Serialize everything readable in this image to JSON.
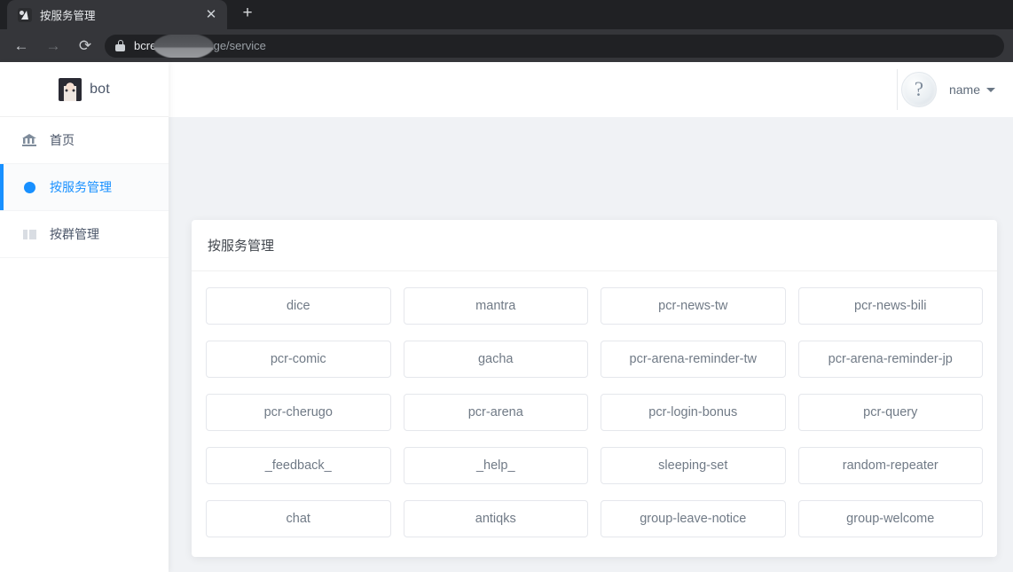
{
  "browser": {
    "tab": {
      "title": "按服务管理",
      "close_label": "✕",
      "favicon": "bot-bolt-icon"
    },
    "new_tab_label": "+",
    "nav": {
      "back": "←",
      "forward": "→",
      "reload": "⟳"
    },
    "omnibox": {
      "lock_icon": "lock-icon",
      "url_host_prefix": "bcr",
      "url_host_suffix": "e.com",
      "url_path": "/manage/service"
    }
  },
  "sidebar": {
    "brand": {
      "avatar": "bot-avatar",
      "name": "bot"
    },
    "items": [
      {
        "label": "首页",
        "icon": "bank-icon",
        "active": false
      },
      {
        "label": "按服务管理",
        "icon": "blue-dot-icon",
        "active": true
      },
      {
        "label": "按群管理",
        "icon": "grid-icon",
        "active": false
      }
    ]
  },
  "header": {
    "avatar_glyph": "?",
    "user_name": "name",
    "caret_icon": "chevron-down-icon"
  },
  "card": {
    "title": "按服务管理",
    "services": [
      "dice",
      "mantra",
      "pcr-news-tw",
      "pcr-news-bili",
      "pcr-comic",
      "gacha",
      "pcr-arena-reminder-tw",
      "pcr-arena-reminder-jp",
      "pcr-cherugo",
      "pcr-arena",
      "pcr-login-bonus",
      "pcr-query",
      "_feedback_",
      "_help_",
      "sleeping-set",
      "random-repeater",
      "chat",
      "antiqks",
      "group-leave-notice",
      "group-welcome"
    ]
  },
  "colors": {
    "accent": "#1890ff",
    "page_bg": "#f0f2f5",
    "card_bg": "#ffffff",
    "text": "#4a5568",
    "muted_text": "#707a86",
    "chrome_dark": "#202124",
    "chrome_tab": "#35363a"
  }
}
